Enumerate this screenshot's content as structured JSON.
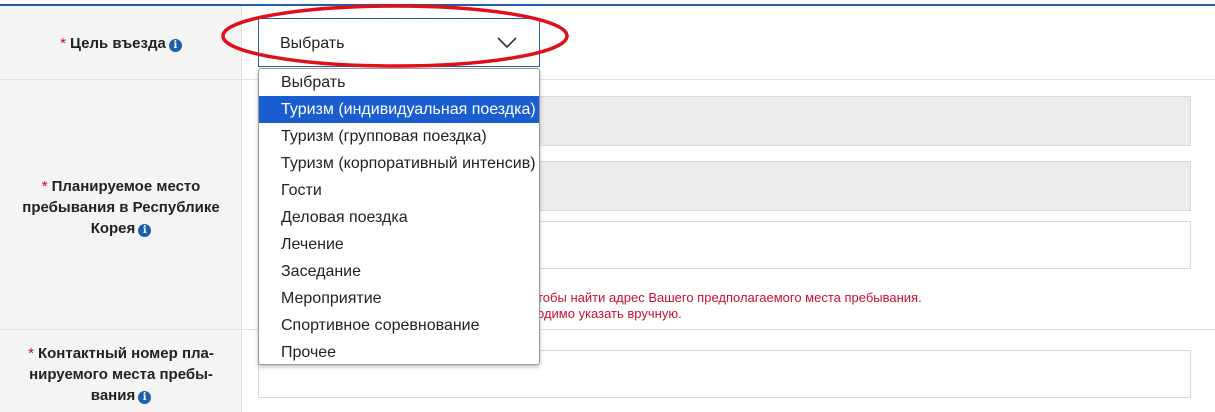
{
  "form": {
    "purpose": {
      "required_mark": "*",
      "label": "Цель въезда",
      "info_icon": "i",
      "select_value": "Выбрать"
    },
    "stay_place": {
      "required_mark": "*",
      "label_line1": "Планируемое место",
      "label_line2": "пребывания в Республике",
      "label_line3": "Корея",
      "info_icon": "i"
    },
    "contact": {
      "required_mark": "*",
      "label_line1": "Контактный номер пла-",
      "label_line2": "нируемого места пребы-",
      "label_line3": "вания",
      "info_icon": "i"
    },
    "error_line1": "тобы найти адрес Вашего предполагаемого места пребывания.",
    "error_line2": "одимо указать вручную."
  },
  "dropdown": {
    "options": [
      "Выбрать",
      "Туризм (индивидуальная поездка)",
      "Туризм (групповая поездка)",
      "Туризм (корпоративный интенсив)",
      "Гости",
      "Деловая поездка",
      "Лечение",
      "Заседание",
      "Мероприятие",
      "Спортивное соревнование",
      "Прочее"
    ],
    "highlighted_index": 1
  },
  "colors": {
    "accent": "#1f5fa8",
    "highlight": "#1a5dd0",
    "error": "#c8102e",
    "annotation_oval": "#e0101a"
  }
}
